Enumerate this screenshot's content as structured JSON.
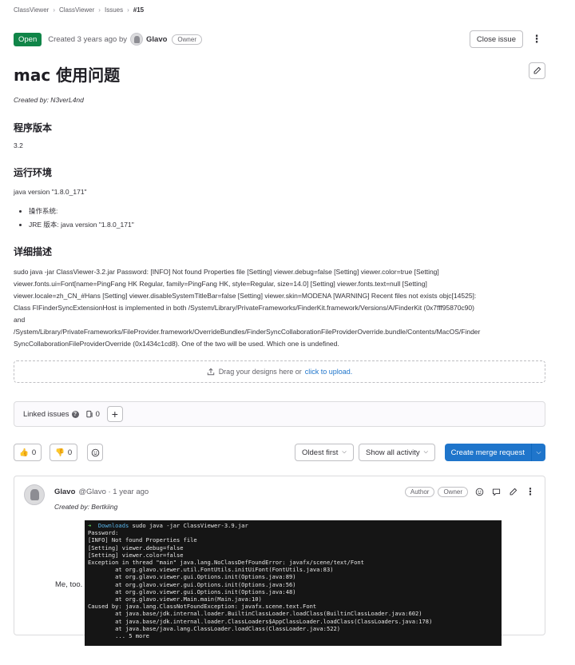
{
  "breadcrumb": [
    "ClassViewer",
    "ClassViewer",
    "Issues",
    "#15"
  ],
  "header": {
    "status": "Open",
    "created_text": "Created 3 years ago by",
    "author": "Glavo",
    "author_role": "Owner",
    "close_label": "Close issue"
  },
  "issue": {
    "title": "mac 使用问题",
    "created_by": "Created by: N3verL4nd",
    "sections": [
      {
        "heading": "程序版本",
        "text": "3.2"
      },
      {
        "heading": "运行环境",
        "text": "java version \"1.8.0_171\""
      },
      {
        "heading": "详细描述"
      }
    ],
    "env_items": [
      "操作系统:",
      "JRE 版本:  java version \"1.8.0_171\""
    ],
    "description": [
      "sudo java -jar ClassViewer-3.2.jar Password: [INFO] Not found Properties file [Setting] viewer.debug=false [Setting] viewer.color=true [Setting]",
      "viewer.fonts.ui=Font[name=PingFang HK Regular, family=PingFang HK, style=Regular, size=14.0] [Setting] viewer.fonts.text=null [Setting]",
      "viewer.locale=zh_CN_#Hans [Setting] viewer.disableSystemTitleBar=false [Setting] viewer.skin=MODENA [WARNING] Recent files not exists objc[14525]:",
      "Class FIFinderSyncExtensionHost is implemented in both /System/Library/PrivateFrameworks/FinderKit.framework/Versions/A/FinderKit (0x7fff95870c90)",
      "and",
      "/System/Library/PrivateFrameworks/FileProvider.framework/OverrideBundles/FinderSyncCollaborationFileProviderOverride.bundle/Contents/MacOS/Finder",
      "SyncCollaborationFileProviderOverride (0x1434c1cd8). One of the two will be used. Which one is undefined."
    ]
  },
  "upload": {
    "text": "Drag your designs here or",
    "link": "click to upload."
  },
  "linked": {
    "label": "Linked issues",
    "count": "0",
    "add": "+"
  },
  "actions": {
    "thumbs_up": "0",
    "thumbs_down": "0",
    "sort": "Oldest first",
    "filter": "Show all activity",
    "create_mr": "Create merge request"
  },
  "note": {
    "author": "Glavo",
    "meta": "@Glavo · 1 year ago",
    "created_by": "Created by: Bertkiing",
    "badges": [
      "Author",
      "Owner"
    ],
    "text": "Me, too.",
    "terminal": [
      {
        "prompt": "➜  ",
        "dir": "Downloads",
        "cmd": " sudo java -jar ClassViewer-3.9.jar"
      },
      {
        "line": "Password:"
      },
      {
        "line": "[INFO] Not found Properties file"
      },
      {
        "line": "[Setting] viewer.debug=false"
      },
      {
        "line": "[Setting] viewer.color=false"
      },
      {
        "line": "Exception in thread \"main\" java.lang.NoClassDefFoundError: javafx/scene/text/Font"
      },
      {
        "line": "        at org.glavo.viewer.util.FontUtils.initUiFont(FontUtils.java:83)"
      },
      {
        "line": "        at org.glavo.viewer.gui.Options.init(Options.java:89)"
      },
      {
        "line": "        at org.glavo.viewer.gui.Options.init(Options.java:56)"
      },
      {
        "line": "        at org.glavo.viewer.gui.Options.init(Options.java:48)"
      },
      {
        "line": "        at org.glavo.viewer.Main.main(Main.java:10)"
      },
      {
        "line": "Caused by: java.lang.ClassNotFoundException: javafx.scene.text.Font"
      },
      {
        "line": "        at java.base/jdk.internal.loader.BuiltinClassLoader.loadClass(BuiltinClassLoader.java:602)"
      },
      {
        "line": "        at java.base/jdk.internal.loader.ClassLoaders$AppClassLoader.loadClass(ClassLoaders.java:178)"
      },
      {
        "line": "        at java.base/java.lang.ClassLoader.loadClass(ClassLoader.java:522)"
      },
      {
        "line": "        ... 5 more"
      }
    ]
  },
  "colors": {
    "accent": "#1f75cb",
    "open": "#108548",
    "terminal_bg": "#151515"
  }
}
